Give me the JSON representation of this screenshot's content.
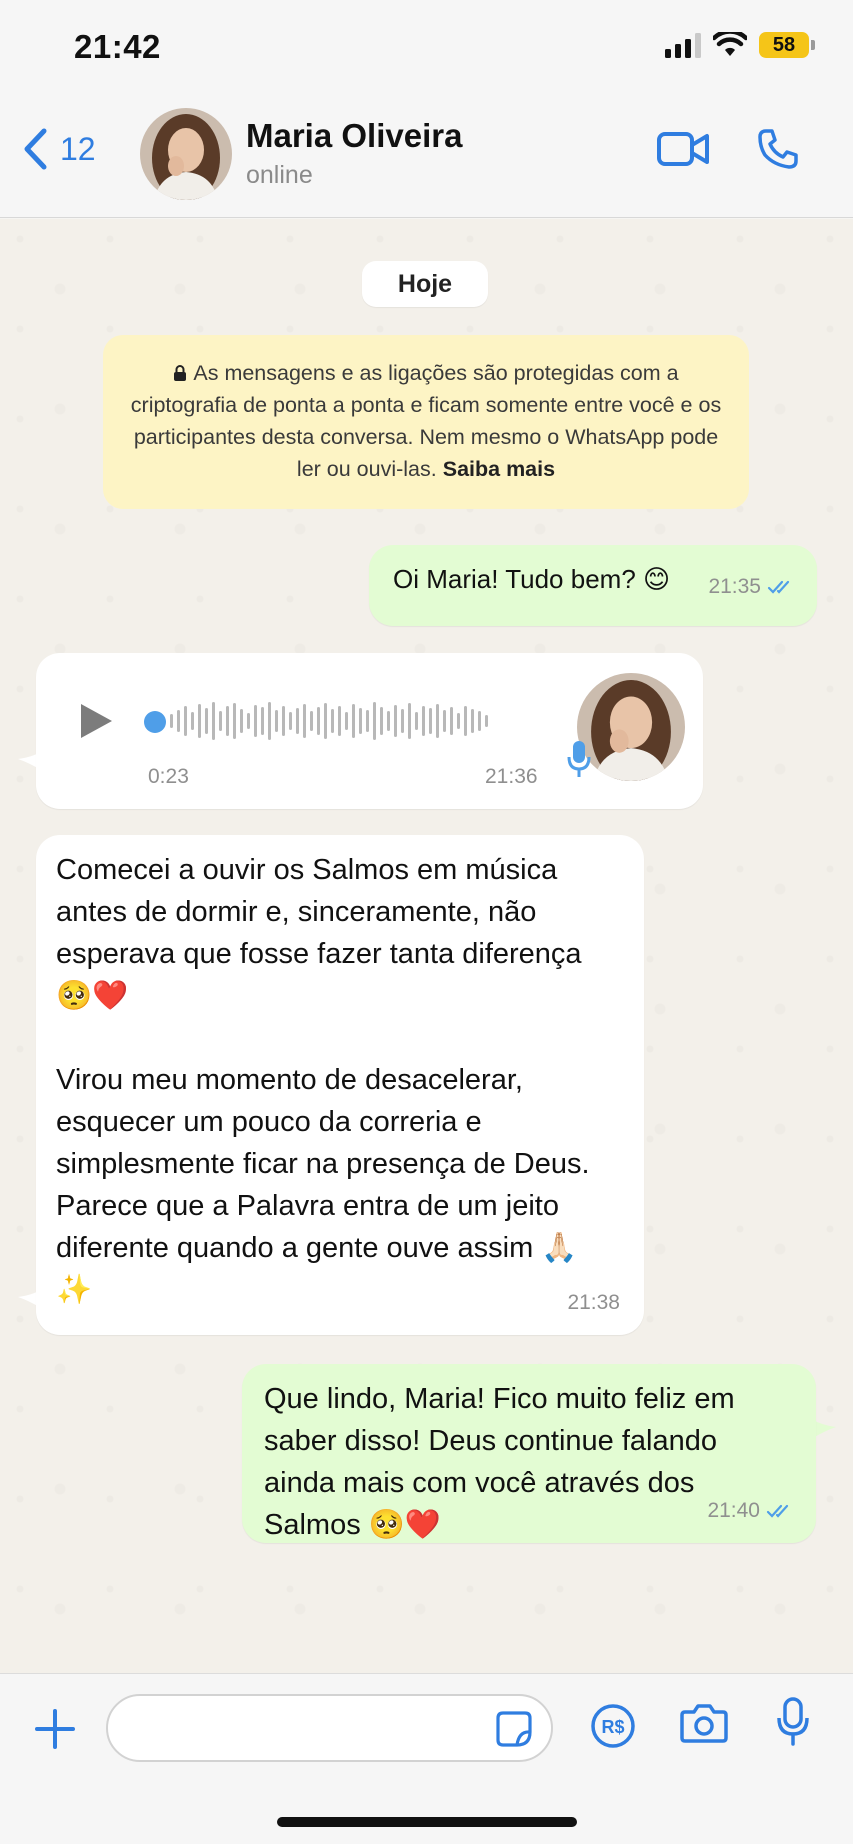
{
  "status_bar": {
    "time": "21:42",
    "battery": "58",
    "icons": [
      "signal-icon",
      "wifi-icon",
      "battery-icon"
    ]
  },
  "header": {
    "back_count": "12",
    "contact_name": "Maria Oliveira",
    "contact_status": "online",
    "accent_color": "#2f7de0",
    "icons": [
      "chevron-left-icon",
      "video-call-icon",
      "phone-icon"
    ]
  },
  "chat": {
    "date_label": "Hoje",
    "encryption_notice": {
      "text": "As mensagens e as ligações são protegidas com a criptografia de ponta a ponta e ficam somente entre você e os participantes desta conversa. Nem mesmo o WhatsApp pode ler ou ouvi-las.",
      "link": "Saiba mais"
    },
    "messages": [
      {
        "direction": "out",
        "text": "Oi Maria! Tudo bem? 😊",
        "time": "21:35",
        "read": true
      },
      {
        "direction": "in",
        "type": "voice",
        "duration": "0:23",
        "time": "21:36",
        "progress": 0
      },
      {
        "direction": "in",
        "text": "Comecei a ouvir os Salmos em música antes de dormir e, sinceramente, não esperava que fosse fazer tanta diferença 🥺❤️\n\nVirou meu momento de desacelerar, esquecer um pouco da correria e simplesmente ficar na presença de Deus. Parece que a Palavra entra de um jeito diferente quando a gente ouve assim 🙏🏻✨",
        "time": "21:38"
      },
      {
        "direction": "out",
        "text": "Que lindo, Maria! Fico muito feliz em saber disso! Deus continue falando ainda mais com você através dos Salmos 🥺❤️",
        "time": "21:40",
        "read": true
      }
    ],
    "colors": {
      "outgoing": "#e3fcd3",
      "incoming": "#ffffff",
      "read_ticks": "#4f9ee8"
    }
  },
  "input_bar": {
    "placeholder": "",
    "icons": [
      "plus-icon",
      "sticker-icon",
      "payment-icon",
      "camera-icon",
      "microphone-icon"
    ]
  }
}
